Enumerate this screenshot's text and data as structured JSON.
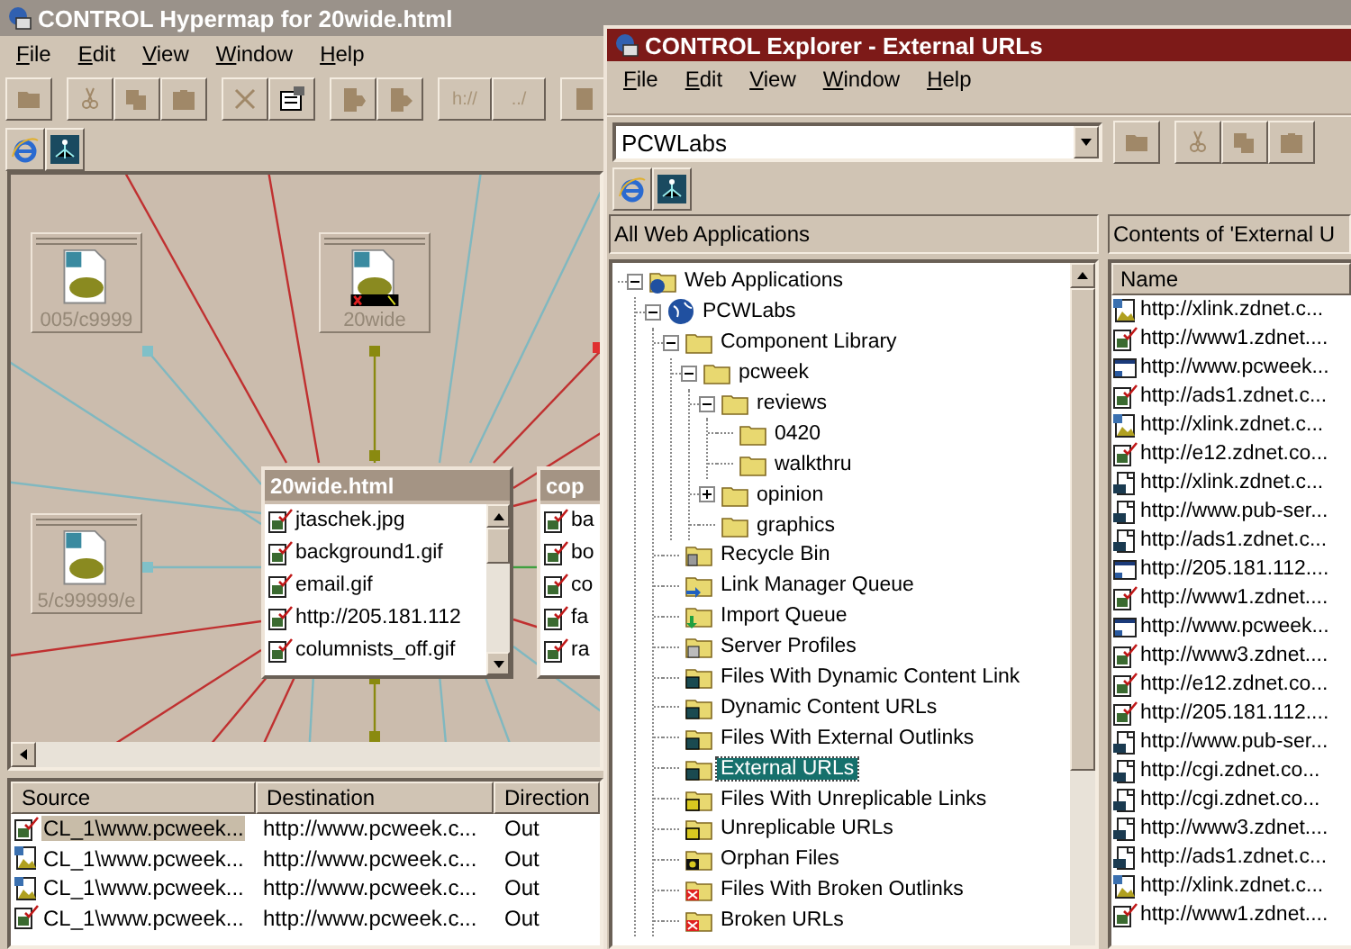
{
  "hypermap": {
    "title": "CONTROL Hypermap for 20wide.html",
    "menu": [
      "File",
      "Edit",
      "View",
      "Window",
      "Help"
    ],
    "toolbar": [
      {
        "kind": "folder"
      },
      {
        "kind": "cut"
      },
      {
        "kind": "copy"
      },
      {
        "kind": "paste"
      },
      {
        "kind": "delete"
      },
      {
        "kind": "properties"
      },
      {
        "kind": "page-in"
      },
      {
        "kind": "page-out"
      },
      {
        "kind": "text",
        "label": "h://"
      },
      {
        "kind": "text",
        "label": "../"
      },
      {
        "kind": "page"
      }
    ],
    "canvas": {
      "nodes": [
        {
          "kind": "page",
          "label": "005/c9999"
        },
        {
          "kind": "broken-page",
          "label": "20wide"
        },
        {
          "kind": "page",
          "label": "5/c99999/e"
        }
      ],
      "windows": [
        {
          "title": "20wide.html",
          "items": [
            "jtaschek.jpg",
            "background1.gif",
            "email.gif",
            "http://205.181.112",
            "columnists_off.gif"
          ]
        },
        {
          "title": "cop",
          "items": [
            "ba",
            "bo",
            "co",
            "fa",
            "ra"
          ]
        }
      ]
    },
    "links_table": {
      "columns": [
        "Source",
        "Destination",
        "Direction"
      ],
      "rows": [
        {
          "kind": "page",
          "source": "CL_1\\www.pcweek...",
          "destination": "http://www.pcweek.c...",
          "direction": "Out",
          "selected": true
        },
        {
          "kind": "image",
          "source": "CL_1\\www.pcweek...",
          "destination": "http://www.pcweek.c...",
          "direction": "Out",
          "selected": false
        },
        {
          "kind": "image",
          "source": "CL_1\\www.pcweek...",
          "destination": "http://www.pcweek.c...",
          "direction": "Out",
          "selected": false
        },
        {
          "kind": "page",
          "source": "CL_1\\www.pcweek...",
          "destination": "http://www.pcweek.c...",
          "direction": "Out",
          "selected": false
        }
      ]
    }
  },
  "explorer": {
    "title": "CONTROL Explorer - External URLs",
    "menu": [
      "File",
      "Edit",
      "View",
      "Window",
      "Help"
    ],
    "location": {
      "value": "PCWLabs"
    },
    "toolbar": [
      {
        "kind": "folder"
      },
      {
        "kind": "cut"
      },
      {
        "kind": "copy"
      },
      {
        "kind": "paste"
      }
    ],
    "tree_header": "All Web Applications",
    "list_header": "Contents of 'External U",
    "tree": [
      {
        "label": "Web Applications",
        "kind": "app",
        "expanded": true,
        "selected": false,
        "children": [
          {
            "label": "PCWLabs",
            "kind": "site",
            "expanded": true,
            "selected": false,
            "children": [
              {
                "label": "Component Library",
                "kind": "folder",
                "expanded": true,
                "selected": false,
                "children": [
                  {
                    "label": "pcweek",
                    "kind": "folder",
                    "expanded": true,
                    "selected": false,
                    "children": [
                      {
                        "label": "reviews",
                        "kind": "folder",
                        "expanded": true,
                        "selected": false,
                        "children": [
                          {
                            "label": "0420",
                            "kind": "folder",
                            "selected": false
                          },
                          {
                            "label": "walkthru",
                            "kind": "folder",
                            "selected": false
                          }
                        ]
                      },
                      {
                        "label": "opinion",
                        "kind": "folder",
                        "expanded": false,
                        "selected": false
                      },
                      {
                        "label": "graphics",
                        "kind": "folder",
                        "selected": false
                      }
                    ]
                  }
                ]
              },
              {
                "label": "Recycle Bin",
                "kind": "recycle",
                "selected": false
              },
              {
                "label": "Link Manager Queue",
                "kind": "queue",
                "selected": false
              },
              {
                "label": "Import Queue",
                "kind": "import",
                "selected": false
              },
              {
                "label": "Server Profiles",
                "kind": "profile",
                "selected": false
              },
              {
                "label": "Files With Dynamic Content Link",
                "kind": "link",
                "selected": false
              },
              {
                "label": "Dynamic Content URLs",
                "kind": "link",
                "selected": false
              },
              {
                "label": "Files With External Outlinks",
                "kind": "link",
                "selected": false
              },
              {
                "label": "External URLs",
                "kind": "link",
                "selected": true
              },
              {
                "label": "Files With Unreplicable Links",
                "kind": "unreplicable",
                "selected": false
              },
              {
                "label": "Unreplicable URLs",
                "kind": "unreplicable",
                "selected": false
              },
              {
                "label": "Orphan Files",
                "kind": "orphan",
                "selected": false
              },
              {
                "label": "Files With Broken Outlinks",
                "kind": "broken",
                "selected": false
              },
              {
                "label": "Broken URLs",
                "kind": "broken",
                "selected": false
              }
            ]
          }
        ]
      }
    ],
    "list": {
      "columns": [
        "Name"
      ],
      "rows": [
        {
          "kind": "image",
          "name": "http://xlink.zdnet.c..."
        },
        {
          "kind": "page",
          "name": "http://www1.zdnet...."
        },
        {
          "kind": "window",
          "name": "http://www.pcweek..."
        },
        {
          "kind": "page",
          "name": "http://ads1.zdnet.c..."
        },
        {
          "kind": "image",
          "name": "http://xlink.zdnet.c..."
        },
        {
          "kind": "page",
          "name": "http://e12.zdnet.co..."
        },
        {
          "kind": "file",
          "name": "http://xlink.zdnet.c..."
        },
        {
          "kind": "file",
          "name": "http://www.pub-ser..."
        },
        {
          "kind": "file",
          "name": "http://ads1.zdnet.c..."
        },
        {
          "kind": "window",
          "name": "http://205.181.112...."
        },
        {
          "kind": "page",
          "name": "http://www1.zdnet...."
        },
        {
          "kind": "window",
          "name": "http://www.pcweek..."
        },
        {
          "kind": "page",
          "name": "http://www3.zdnet...."
        },
        {
          "kind": "page",
          "name": "http://e12.zdnet.co..."
        },
        {
          "kind": "page",
          "name": "http://205.181.112...."
        },
        {
          "kind": "file",
          "name": "http://www.pub-ser..."
        },
        {
          "kind": "file",
          "name": "http://cgi.zdnet.co..."
        },
        {
          "kind": "file",
          "name": "http://cgi.zdnet.co..."
        },
        {
          "kind": "file",
          "name": "http://www3.zdnet...."
        },
        {
          "kind": "file",
          "name": "http://ads1.zdnet.c..."
        },
        {
          "kind": "image",
          "name": "http://xlink.zdnet.c..."
        },
        {
          "kind": "page",
          "name": "http://www1.zdnet...."
        }
      ]
    }
  }
}
